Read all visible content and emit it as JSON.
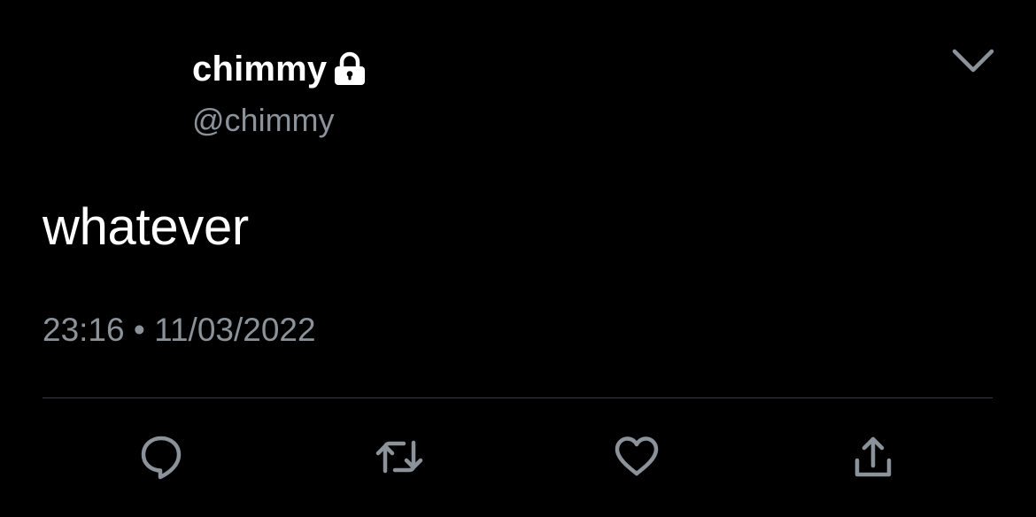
{
  "tweet": {
    "display_name": "chimmy",
    "handle": "@chimmy",
    "text": "whatever",
    "time": "23:16",
    "separator": "•",
    "date": "11/03/2022",
    "protected_icon": "lock-icon",
    "menu_icon": "chevron-down-icon"
  },
  "actions": [
    {
      "name": "reply",
      "icon": "reply-icon"
    },
    {
      "name": "retweet",
      "icon": "retweet-icon"
    },
    {
      "name": "like",
      "icon": "heart-icon"
    },
    {
      "name": "share",
      "icon": "share-icon"
    }
  ],
  "colors": {
    "background": "#000000",
    "primary_text": "#ffffff",
    "secondary_text": "#8b9299",
    "icon": "#8b9299",
    "divider": "#3a3d41"
  }
}
